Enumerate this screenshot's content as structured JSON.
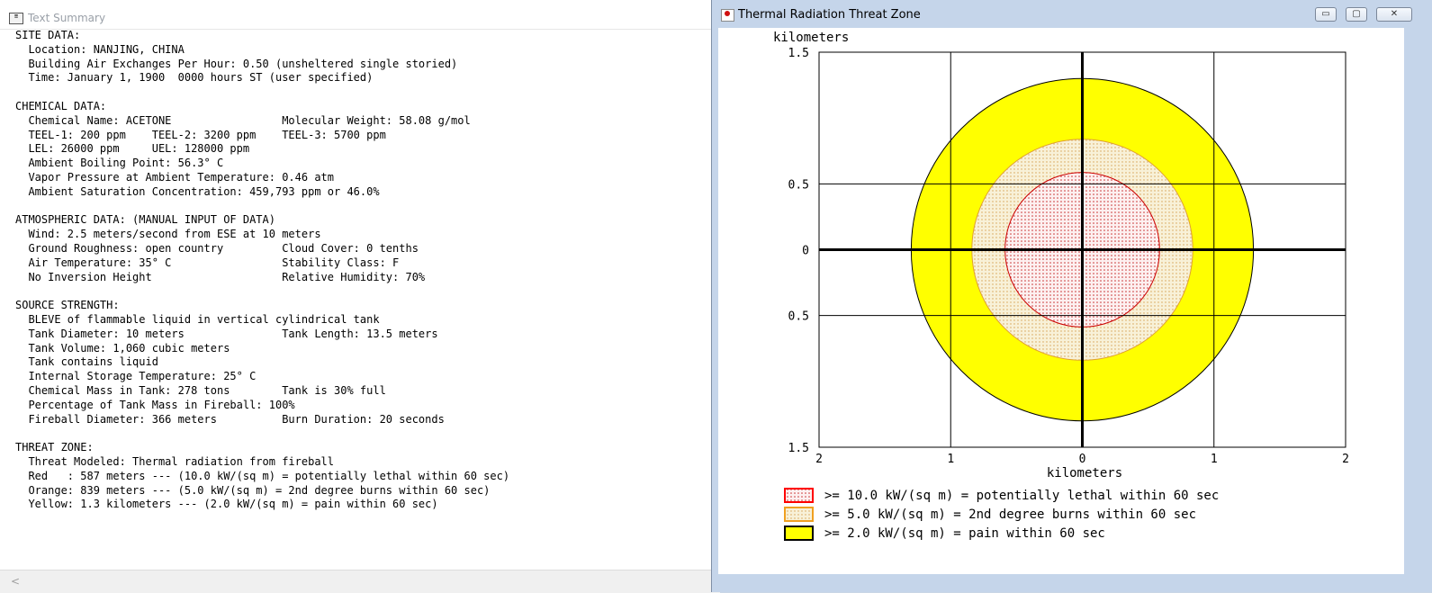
{
  "left_window": {
    "title": "Text Summary",
    "icon": "notepad-icon",
    "lines": [
      "SITE DATA:",
      "  Location: NANJING, CHINA",
      "  Building Air Exchanges Per Hour: 0.50 (unsheltered single storied)",
      "  Time: January 1, 1900  0000 hours ST (user specified)",
      "",
      "CHEMICAL DATA:",
      "  Chemical Name: ACETONE                 Molecular Weight: 58.08 g/mol",
      "  TEEL-1: 200 ppm    TEEL-2: 3200 ppm    TEEL-3: 5700 ppm",
      "  LEL: 26000 ppm     UEL: 128000 ppm",
      "  Ambient Boiling Point: 56.3° C",
      "  Vapor Pressure at Ambient Temperature: 0.46 atm",
      "  Ambient Saturation Concentration: 459,793 ppm or 46.0%",
      "",
      "ATMOSPHERIC DATA: (MANUAL INPUT OF DATA)",
      "  Wind: 2.5 meters/second from ESE at 10 meters",
      "  Ground Roughness: open country         Cloud Cover: 0 tenths",
      "  Air Temperature: 35° C                 Stability Class: F",
      "  No Inversion Height                    Relative Humidity: 70%",
      "",
      "SOURCE STRENGTH:",
      "  BLEVE of flammable liquid in vertical cylindrical tank",
      "  Tank Diameter: 10 meters               Tank Length: 13.5 meters",
      "  Tank Volume: 1,060 cubic meters",
      "  Tank contains liquid",
      "  Internal Storage Temperature: 25° C",
      "  Chemical Mass in Tank: 278 tons        Tank is 30% full",
      "  Percentage of Tank Mass in Fireball: 100%",
      "  Fireball Diameter: 366 meters          Burn Duration: 20 seconds",
      "",
      "THREAT ZONE:",
      "  Threat Modeled: Thermal radiation from fireball",
      "  Red   : 587 meters --- (10.0 kW/(sq m) = potentially lethal within 60 sec)",
      "  Orange: 839 meters --- (5.0 kW/(sq m) = 2nd degree burns within 60 sec)",
      "  Yellow: 1.3 kilometers --- (2.0 kW/(sq m) = pain within 60 sec)"
    ],
    "scroll_arrow": "<"
  },
  "right_window": {
    "title": "Thermal Radiation Threat Zone",
    "icon": "threat-zone-icon",
    "controls": {
      "minimize": "▭",
      "maximize": "▢",
      "close": "✕"
    }
  },
  "chart_data": {
    "type": "threat-zone-circles",
    "ylabel": "kilometers",
    "xlabel": "kilometers",
    "xlim": [
      -2,
      2
    ],
    "ylim": [
      -1.5,
      1.5
    ],
    "x_ticks": [
      {
        "value": -2,
        "label": "2"
      },
      {
        "value": -1,
        "label": "1"
      },
      {
        "value": 0,
        "label": "0"
      },
      {
        "value": 1,
        "label": "1"
      },
      {
        "value": 2,
        "label": "2"
      }
    ],
    "y_ticks": [
      {
        "value": 1.5,
        "label": "1.5"
      },
      {
        "value": 0.5,
        "label": "0.5"
      },
      {
        "value": 0,
        "label": "0"
      },
      {
        "value": -0.5,
        "label": "0.5"
      },
      {
        "value": -1.5,
        "label": "1.5"
      }
    ],
    "grid": true,
    "zones": [
      {
        "name": "Yellow",
        "radius_km": 1.3,
        "fill": "#ffff00",
        "stroke": "#000000",
        "pattern": "solid"
      },
      {
        "name": "Orange",
        "radius_km": 0.839,
        "fill": "#f7efd0",
        "stroke": "#e0a030",
        "pattern": "dots-orange"
      },
      {
        "name": "Red",
        "radius_km": 0.587,
        "fill": "#fdeeee",
        "stroke": "#cc0000",
        "pattern": "dots-red"
      }
    ],
    "legend": {
      "placement": "bottom",
      "entries": [
        {
          "label": ">= 10.0 kW/(sq m) = potentially lethal within 60 sec",
          "swatch": "#ff0000"
        },
        {
          "label": ">= 5.0 kW/(sq m) = 2nd degree burns within 60 sec",
          "swatch": "#f0a020"
        },
        {
          "label": ">= 2.0 kW/(sq m) = pain within 60 sec",
          "swatch": "#ffff00"
        }
      ]
    }
  }
}
